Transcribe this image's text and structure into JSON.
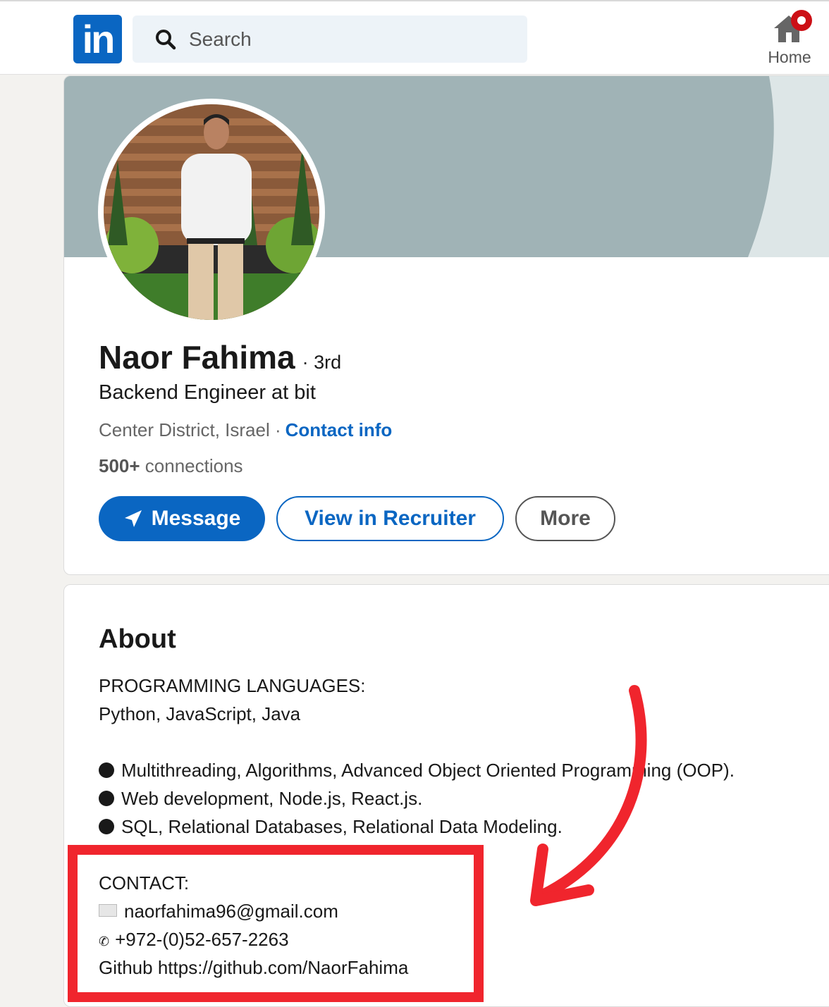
{
  "header": {
    "logo_text": "in",
    "search_placeholder": "Search",
    "home_label": "Home"
  },
  "profile": {
    "name": "Naor Fahima",
    "degree": "· 3rd",
    "headline": "Backend Engineer at bit",
    "location": "Center District, Israel ·",
    "contact_info": "Contact info",
    "connections_count": "500+",
    "connections_label": " connections",
    "buttons": {
      "message": "Message",
      "recruiter": "View in Recruiter",
      "more": "More"
    }
  },
  "about": {
    "title": "About",
    "lines": [
      "PROGRAMMING LANGUAGES:",
      "Python, JavaScript, Java"
    ],
    "bullets": [
      "Multithreading, Algorithms, Advanced Object Oriented Programming (OOP).",
      "Web development, Node.js, React.js.",
      "SQL, Relational Databases, Relational Data Modeling."
    ],
    "contact": {
      "heading": "CONTACT:",
      "email": "naorfahima96@gmail.com",
      "phone_glyph": "✆",
      "phone": "+972-(0)52-657-2263",
      "github": "Github https://github.com/NaorFahima"
    }
  },
  "colors": {
    "brand": "#0a66c2",
    "annotation": "#f0252d"
  }
}
